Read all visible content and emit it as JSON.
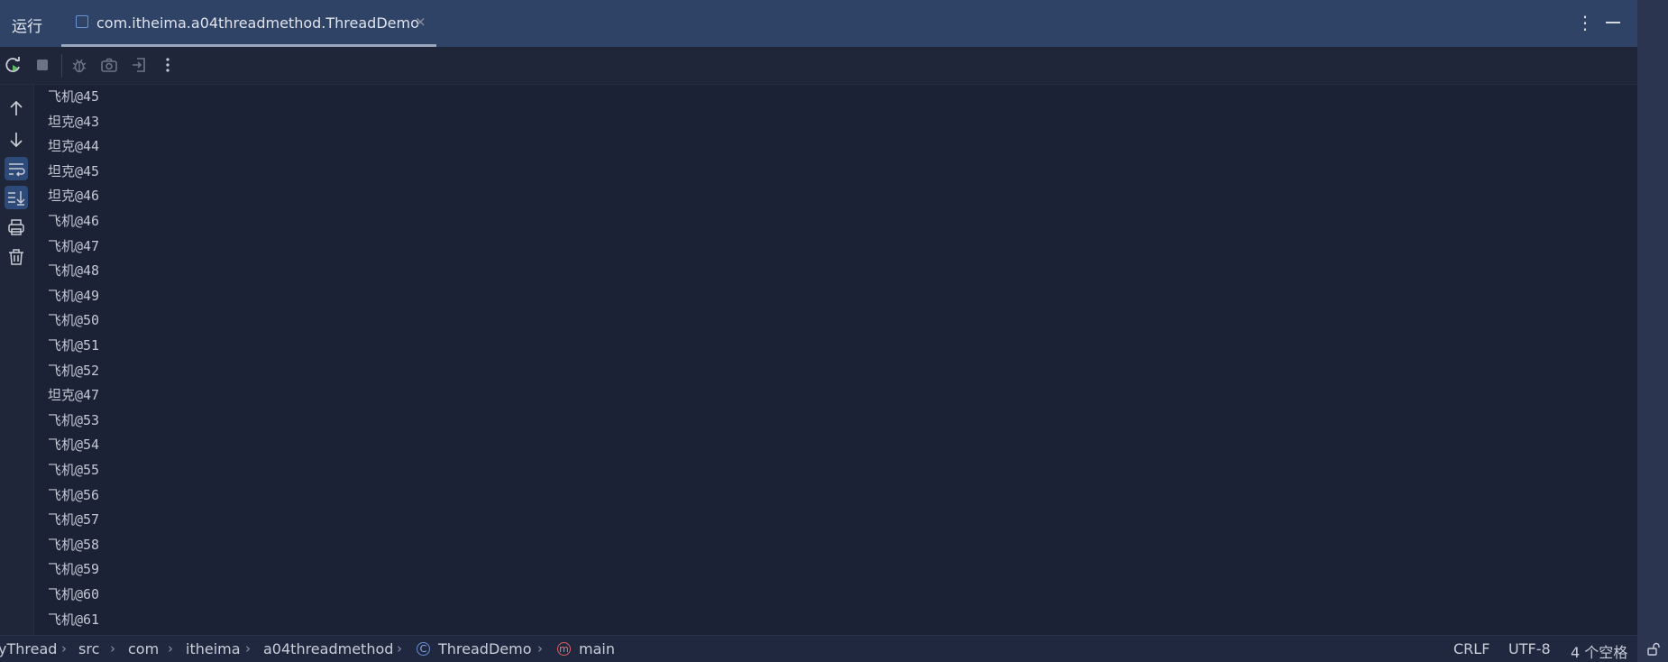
{
  "titlebar": {
    "run_label": "运行",
    "tab_label": "com.itheima.a04threadmethod.ThreadDemo",
    "tab_close": "×",
    "more_icon": "more-vertical-icon",
    "minimize_icon": "minimize-icon"
  },
  "toolbar": {
    "icons": [
      "rerun-icon",
      "stop-icon",
      "debug-icon",
      "camera-icon",
      "exit-icon",
      "more-vertical-icon"
    ]
  },
  "gutter": {
    "icons": [
      "arrow-up-icon",
      "arrow-down-icon",
      "soft-wrap-icon",
      "scroll-to-end-icon",
      "print-icon",
      "trash-icon"
    ]
  },
  "console": {
    "lines": [
      "飞机@45",
      "坦克@43",
      "坦克@44",
      "坦克@45",
      "坦克@46",
      "飞机@46",
      "飞机@47",
      "飞机@48",
      "飞机@49",
      "飞机@50",
      "飞机@51",
      "飞机@52",
      "坦克@47",
      "飞机@53",
      "飞机@54",
      "飞机@55",
      "飞机@56",
      "飞机@57",
      "飞机@58",
      "飞机@59",
      "飞机@60",
      "飞机@61"
    ]
  },
  "statusbar": {
    "breadcrumbs": [
      "yThread",
      "src",
      "com",
      "itheima",
      "a04threadmethod",
      "ThreadDemo",
      "main"
    ],
    "line_ending": "CRLF",
    "encoding": "UTF-8",
    "indent": "4 个空格",
    "class_badge": "C",
    "method_badge": "m"
  },
  "colors": {
    "accent": "#6b8fd6",
    "background": "#1c2236",
    "titlebar": "#2f4366",
    "run_green": "#5fb865",
    "method_red": "#d86060"
  }
}
